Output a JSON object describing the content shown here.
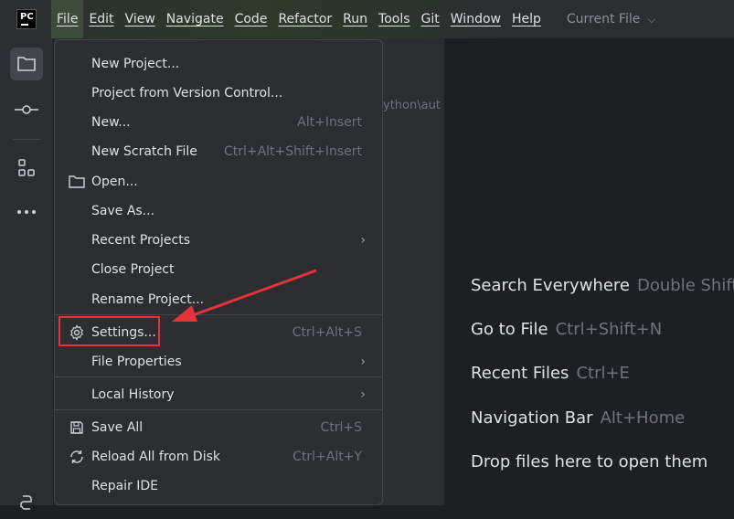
{
  "app": {
    "logo_text": "PC"
  },
  "menubar": {
    "items": [
      "File",
      "Edit",
      "View",
      "Navigate",
      "Code",
      "Refactor",
      "Run",
      "Tools",
      "Git",
      "Window",
      "Help"
    ],
    "run_config": "Current File"
  },
  "project_pane": {
    "path_fragment": "ython\\aut"
  },
  "file_menu": {
    "new_project": "New Project...",
    "project_vcs": "Project from Version Control...",
    "new": "New...",
    "new_shortcut": "Alt+Insert",
    "new_scratch": "New Scratch File",
    "new_scratch_shortcut": "Ctrl+Alt+Shift+Insert",
    "open": "Open...",
    "save_as": "Save As...",
    "recent_projects": "Recent Projects",
    "close_project": "Close Project",
    "rename_project": "Rename Project...",
    "settings": "Settings...",
    "settings_shortcut": "Ctrl+Alt+S",
    "file_properties": "File Properties",
    "local_history": "Local History",
    "save_all": "Save All",
    "save_all_shortcut": "Ctrl+S",
    "reload": "Reload All from Disk",
    "reload_shortcut": "Ctrl+Alt+Y",
    "repair_ide": "Repair IDE"
  },
  "editor_hints": [
    {
      "label": "Search Everywhere",
      "key": "Double Shift"
    },
    {
      "label": "Go to File",
      "key": "Ctrl+Shift+N"
    },
    {
      "label": "Recent Files",
      "key": "Ctrl+E"
    },
    {
      "label": "Navigation Bar",
      "key": "Alt+Home"
    },
    {
      "label": "Drop files here to open them",
      "key": ""
    }
  ],
  "colors": {
    "annotation": "#e5333a",
    "menu_bg": "#2b2d30",
    "editor_bg": "#1e1f22"
  }
}
